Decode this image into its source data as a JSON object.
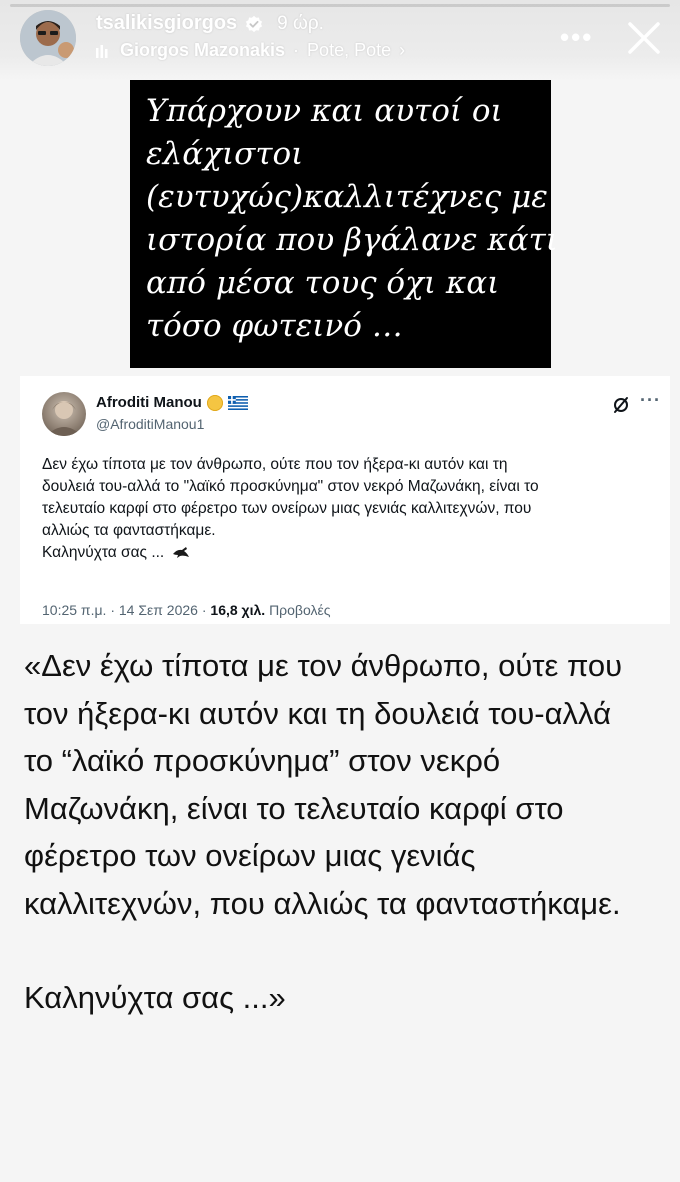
{
  "story": {
    "username": "tsalikisgiorgos",
    "time_ago": "9 ώρ.",
    "music_artist": "Giorgos Mazonakis",
    "music_separator": "·",
    "music_song": "Pote, Pote",
    "music_chevron": "›",
    "more_label": "•••",
    "close_label": "Close"
  },
  "quote_block": {
    "lines": [
      "Υπάρχουν και αυτοί οι",
      "ελάχιστοι",
      "(ευτυχώς)καλλιτέχνες με",
      "ιστορία που βγάλανε κάτι",
      "από μέσα τους όχι και",
      "τόσο φωτεινό …"
    ]
  },
  "tweet": {
    "name": "Afroditi Manou",
    "handle": "@AfroditiManou1",
    "more_label": "···",
    "text_lines": [
      "Δεν έχω τίποτα με τον άνθρωπο, ούτε που τον ήξερα-κι αυτόν και τη",
      "δουλειά του-αλλά το \"λαϊκό προσκύνημα\" στον νεκρό Μαζωνάκη, είναι το",
      "τελευταίο καρφί στο φέρετρο των ονείρων μιας γενιάς καλλιτεχνών, που",
      "αλλιώς τα φανταστήκαμε.",
      "Καληνύχτα σας ..."
    ],
    "time": "10:25 π.μ.",
    "date": "14 Σεπ 2026",
    "views": "16,8 χιλ.",
    "views_label": "Προβολές"
  },
  "big_quote": {
    "lines": [
      "«Δεν έχω τίποτα με τον άνθρωπο, ούτε που",
      "τον ήξερα-κι αυτόν και τη δουλειά του-αλλά",
      "το “λαϊκό προσκύνημα” στον νεκρό",
      "Μαζωνάκη, είναι το τελευταίο καρφί στο",
      "φέρετρο των ονείρων μιας γενιάς",
      "καλλιτεχνών, που αλλιώς τα φανταστήκαμε."
    ],
    "closing": "Καληνύχτα σας ...»"
  },
  "colors": {
    "page_bg": "#f5f5f5",
    "quote_bg": "#000000",
    "verified_blue": "#1d9bf0",
    "flag_blue": "#0d5eaf"
  }
}
